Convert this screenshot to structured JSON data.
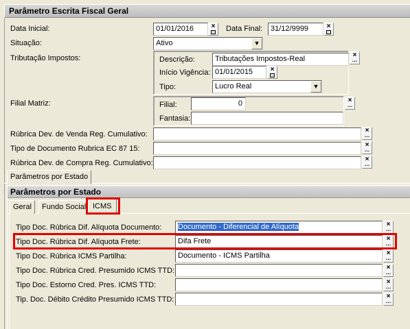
{
  "header": {
    "title": "Parâmetro Escrita Fiscal Geral"
  },
  "form": {
    "data_inicial_label": "Data Inicial:",
    "data_inicial_value": "01/01/2016",
    "data_final_label": "Data Final:",
    "data_final_value": "31/12/9999",
    "situacao_label": "Situação:",
    "situacao_value": "Ativo",
    "tributacao_label": "Tributação Impostos:",
    "tributacao": {
      "descricao_label": "Descrição:",
      "descricao_value": "Tributações Impostos-Real",
      "inicio_label": "Início Vigência:",
      "inicio_value": "01/01/2015",
      "tipo_label": "Tipo:",
      "tipo_value": "Lucro Real"
    },
    "filial_matriz_label": "Filial Matriz:",
    "filial": {
      "filial_label": "Filial:",
      "filial_value": "0",
      "fantasia_label": "Fantasia:",
      "fantasia_value": ""
    },
    "rubrica_venda_label": "Rúbrica Dev. de Venda Reg. Cumulativo:",
    "rubrica_venda_value": "",
    "tipo_doc_ec_label": "Tipo de Documento Rubrica EC 87 15:",
    "tipo_doc_ec_value": "",
    "rubrica_compra_label": "Rúbrica Dev. de Compra Reg. Cumulativo:",
    "rubrica_compra_value": ""
  },
  "outer_tab": {
    "label": "Parâmetros por Estado"
  },
  "estado": {
    "title": "Parâmetros por Estado",
    "tabs": [
      "Geral",
      "Fundo Social",
      "ICMS"
    ],
    "rows": [
      {
        "label": "Tipo Doc. Rúbrica Dif. Alíquota Documento:",
        "value": "Documento - Diferencial de Alíquota"
      },
      {
        "label": "Tipo Doc. Rúbrica Dif. Alíquota Frete:",
        "value": "Difa Frete"
      },
      {
        "label": "Tipo Doc. Rúbrica ICMS Partilha:",
        "value": "Documento - ICMS Partilha"
      },
      {
        "label": "Tipo Doc. Rúbrica Cred. Presumido ICMS TTD:",
        "value": ""
      },
      {
        "label": "Tipo Doc. Estorno Cred. Pres. ICMS TTD:",
        "value": ""
      },
      {
        "label": "Tip. Doc. Débito Crédito Presumido ICMS TTD:",
        "value": ""
      }
    ]
  },
  "icons": {
    "clear": "x-icon",
    "lookup": "ellipsis-icon",
    "calendar": "calendar-icon",
    "dropdown": "chevron-down-icon"
  },
  "colors": {
    "highlight": "#e00000",
    "selection": "#3169c6"
  }
}
